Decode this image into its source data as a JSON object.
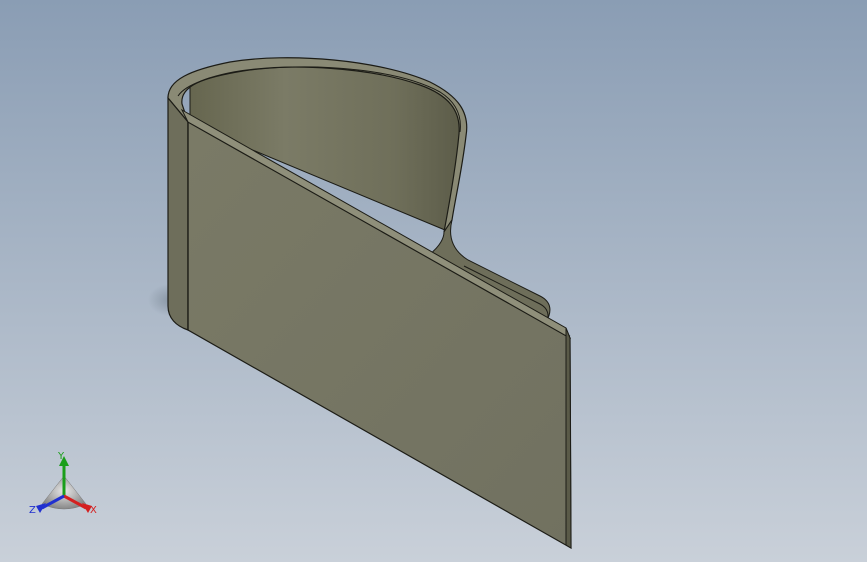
{
  "viewport": {
    "background_top": "#8a9db4",
    "background_bottom": "#c9d0d9",
    "part_color": "#75755f",
    "part_dark": "#5f5f4c",
    "part_light": "#8a8a74",
    "edge_color": "#1c1c16"
  },
  "triad": {
    "x_label": "X",
    "y_label": "Y",
    "z_label": "Z",
    "x_color": "#d42020",
    "y_color": "#1a9e1a",
    "z_color": "#2030d0"
  }
}
